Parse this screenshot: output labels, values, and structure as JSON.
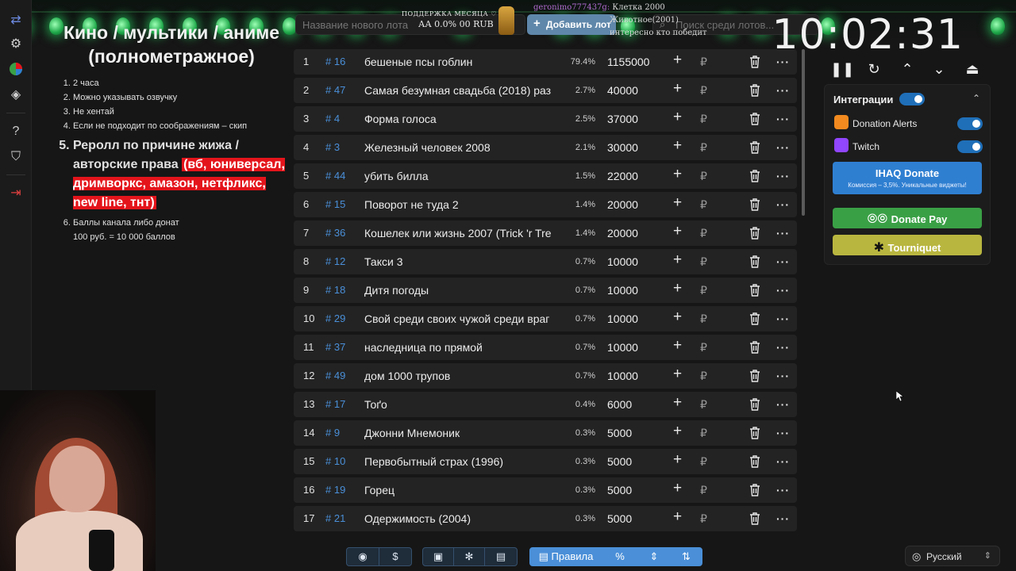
{
  "overlay": {
    "support_title": "ПОДДЕРЖКА МЕСЯЦА ♡",
    "support_value": "АА 0.0% 00 RUB",
    "chat": [
      {
        "user": "geronimo777437g:",
        "text": "Клетка 2000"
      },
      {
        "user": "",
        "text": "Животное(2001)"
      },
      {
        "user": "",
        "text": "интересно кто победит"
      }
    ]
  },
  "header": {
    "name_placeholder": "Название нового лота",
    "add_button": "Добавить лот",
    "search_placeholder": "Поиск среди лотов...",
    "timer": "10:02:31"
  },
  "rules": {
    "title": "Кино / мультики / аниме (полнометражное)",
    "items": [
      "2 часа",
      "Можно указывать озвучку",
      "Не хентай",
      "Если не подходит по соображениям – скип"
    ],
    "item5_plain": "Реролл по причине жижа / авторские права ",
    "item5_red": "(вб, юниверсал, дримворкс, амазон, нетфликс, new line, тнт)",
    "item6_line1": "Баллы канала либо донат",
    "item6_line2": "100 руб. = 10 000 баллов"
  },
  "lots": [
    {
      "n": "1",
      "id": "# 16",
      "name": "бешеные псы гоблин",
      "pct": "79.4%",
      "amount": "1155000"
    },
    {
      "n": "2",
      "id": "# 47",
      "name": "Самая безумная свадьба (2018) раз",
      "pct": "2.7%",
      "amount": "40000"
    },
    {
      "n": "3",
      "id": "# 4",
      "name": "Форма голоса",
      "pct": "2.5%",
      "amount": "37000"
    },
    {
      "n": "4",
      "id": "# 3",
      "name": "Железный человек 2008",
      "pct": "2.1%",
      "amount": "30000"
    },
    {
      "n": "5",
      "id": "# 44",
      "name": "убить билла",
      "pct": "1.5%",
      "amount": "22000"
    },
    {
      "n": "6",
      "id": "# 15",
      "name": "Поворот не туда 2",
      "pct": "1.4%",
      "amount": "20000"
    },
    {
      "n": "7",
      "id": "# 36",
      "name": "Кошелек или жизнь 2007 (Trick 'r Tre",
      "pct": "1.4%",
      "amount": "20000"
    },
    {
      "n": "8",
      "id": "# 12",
      "name": "Такси 3",
      "pct": "0.7%",
      "amount": "10000"
    },
    {
      "n": "9",
      "id": "# 18",
      "name": "Дитя погоды",
      "pct": "0.7%",
      "amount": "10000"
    },
    {
      "n": "10",
      "id": "# 29",
      "name": "Свой среди своих чужой среди враг",
      "pct": "0.7%",
      "amount": "10000"
    },
    {
      "n": "11",
      "id": "# 37",
      "name": "наследница по прямой",
      "pct": "0.7%",
      "amount": "10000"
    },
    {
      "n": "12",
      "id": "# 49",
      "name": "дом 1000 трупов",
      "pct": "0.7%",
      "amount": "10000"
    },
    {
      "n": "13",
      "id": "# 17",
      "name": "Тоґо",
      "pct": "0.4%",
      "amount": "6000"
    },
    {
      "n": "14",
      "id": "# 9",
      "name": "Джонни Мнемоник",
      "pct": "0.3%",
      "amount": "5000"
    },
    {
      "n": "15",
      "id": "# 10",
      "name": "Первобытный страх (1996)",
      "pct": "0.3%",
      "amount": "5000"
    },
    {
      "n": "16",
      "id": "# 19",
      "name": "Горец",
      "pct": "0.3%",
      "amount": "5000"
    },
    {
      "n": "17",
      "id": "# 21",
      "name": "Одержимость (2004)",
      "pct": "0.3%",
      "amount": "5000"
    }
  ],
  "row_symbols": {
    "plus": "+",
    "currency": "₽",
    "more": "···"
  },
  "integrations": {
    "title": "Интеграции",
    "services": [
      {
        "name": "Donation Alerts",
        "color": "#f28a1f"
      },
      {
        "name": "Twitch",
        "color": "#9146ff"
      }
    ],
    "ihaq_label": "IHAQ Donate",
    "ihaq_sub": "Комиссия – 3,5%. Уникальные виджеты!",
    "donatepay_label": "Donate Pay",
    "tourniquet_label": "Tourniquet",
    "colors": {
      "ihaq": "#2f7fd1",
      "donatepay": "#3aa046",
      "tourniquet": "#b9b640"
    }
  },
  "toolbar": {
    "rules_label": "Правила",
    "percent_label": "%"
  },
  "language": {
    "selected": "Русский"
  }
}
